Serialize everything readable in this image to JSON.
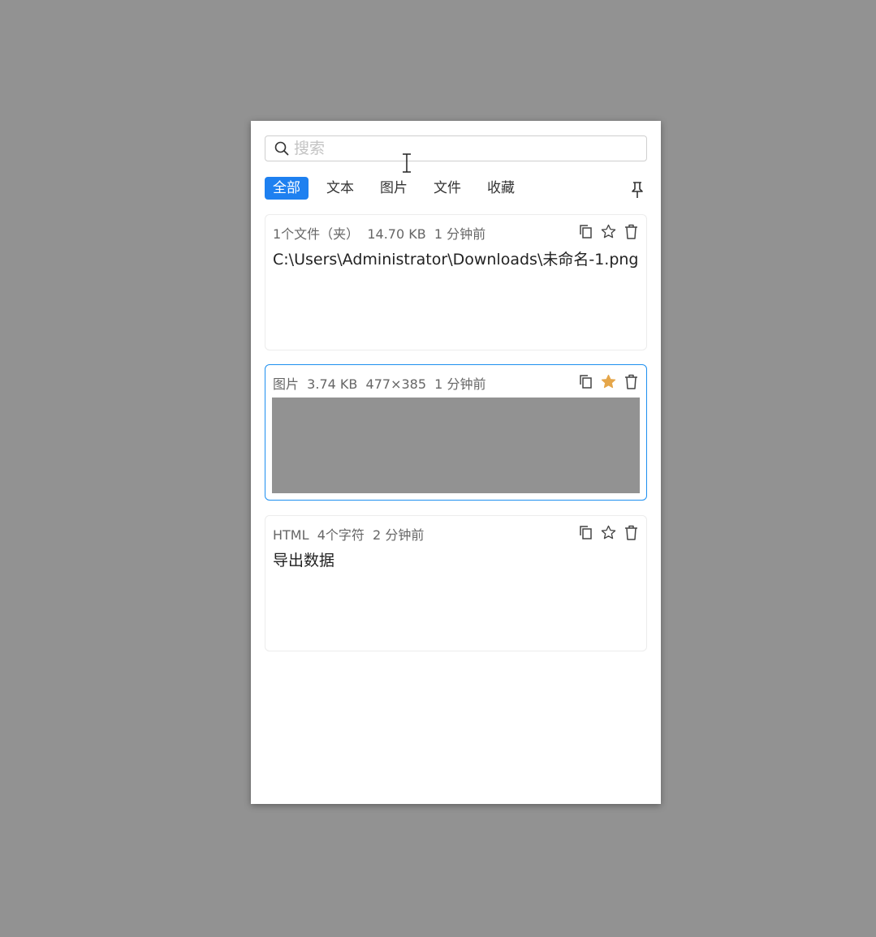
{
  "search": {
    "placeholder": "搜索",
    "value": ""
  },
  "tabs": [
    {
      "label": "全部",
      "active": true
    },
    {
      "label": "文本",
      "active": false
    },
    {
      "label": "图片",
      "active": false
    },
    {
      "label": "文件",
      "active": false
    },
    {
      "label": "收藏",
      "active": false
    }
  ],
  "items": [
    {
      "meta": "1个文件（夹）  14.70 KB  1 分钟前",
      "content": "C:\\Users\\Administrator\\Downloads\\未命名-1.png",
      "favorite": false
    },
    {
      "meta": "图片  3.74 KB  477×385  1 分钟前",
      "content": "",
      "favorite": true
    },
    {
      "meta": "HTML  4个字符  2 分钟前",
      "content": "导出数据",
      "favorite": false
    }
  ],
  "colors": {
    "accent": "#1e80f0",
    "favorite": "#e5a64a",
    "background": "#929292"
  }
}
